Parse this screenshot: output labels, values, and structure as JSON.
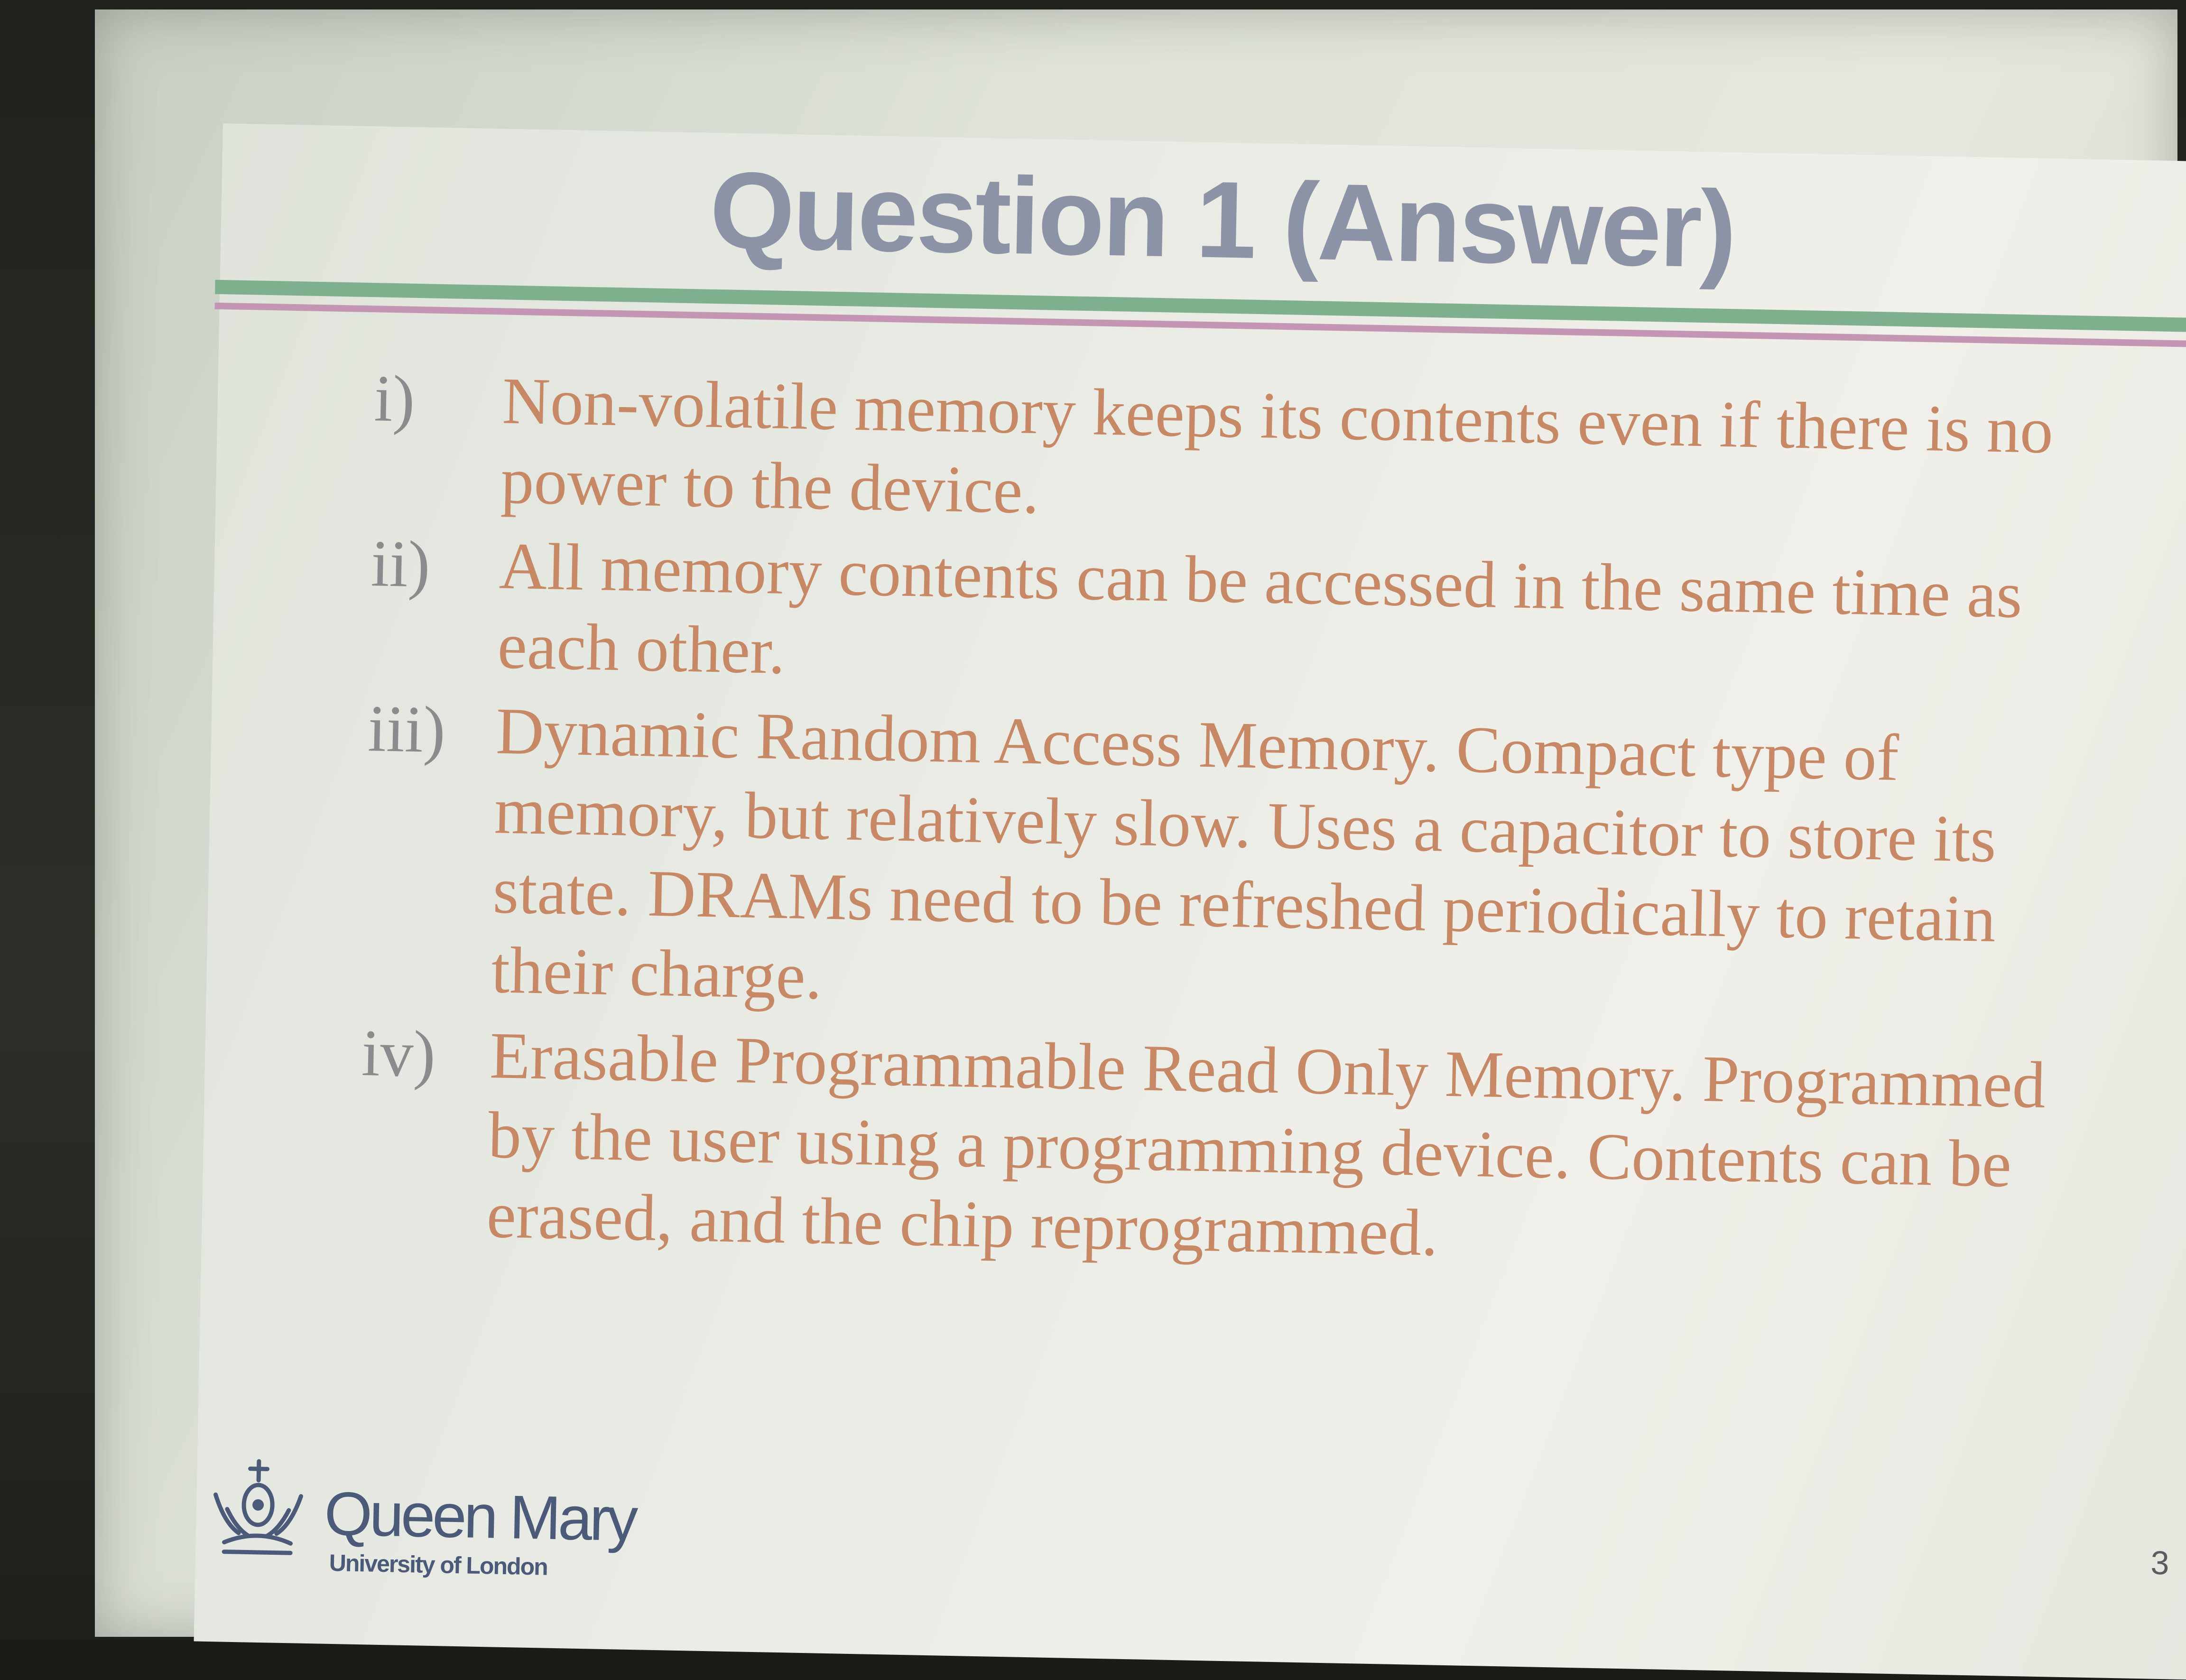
{
  "slide": {
    "title": "Question 1 (Answer)",
    "items": [
      {
        "marker": "i)",
        "text": "Non-volatile memory keeps its contents even if there is no power to the device."
      },
      {
        "marker": "ii)",
        "text": "All memory contents can be accessed in the same time as each other."
      },
      {
        "marker": "iii)",
        "text": "Dynamic Random Access Memory. Compact type of memory, but relatively slow. Uses a capacitor to store its state. DRAMs need to be refreshed periodically to retain their charge."
      },
      {
        "marker": "iv)",
        "text": "Erasable Programmable Read Only Memory. Programmed by the user using a programming device. Contents can be erased, and the chip reprogrammed."
      }
    ],
    "logo": {
      "name": "Queen Mary",
      "subtitle": "University of London"
    },
    "page_number": "3"
  },
  "colors": {
    "title": "#8d93a6",
    "body_text": "#c78866",
    "marker": "#8b8a8c",
    "rule_green": "#7fb08d",
    "rule_pink": "#c596b3",
    "logo": "#4b5a78"
  }
}
